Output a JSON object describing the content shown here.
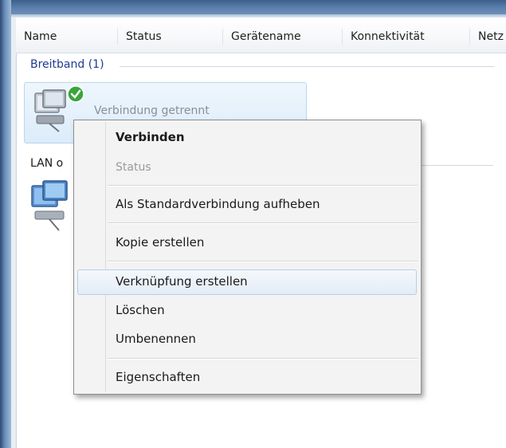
{
  "columns": [
    "Name",
    "Status",
    "Gerätename",
    "Konnektivität",
    "Netz"
  ],
  "groups": {
    "broadband": {
      "label": "Breitband (1)"
    },
    "lan": {
      "label": "LAN o"
    }
  },
  "connection": {
    "name": "Verbindung getrennt",
    "icon": "network-computer-icon",
    "badge_icon": "check-badge-icon"
  },
  "context_menu": {
    "items": [
      {
        "label": "Verbinden",
        "style": "bold"
      },
      {
        "label": "Status",
        "style": "disabled"
      },
      {
        "label": "Als Standardverbindung aufheben"
      },
      {
        "label": "Kopie erstellen"
      },
      {
        "label": "Verknüpfung erstellen",
        "state": "hover"
      },
      {
        "label": "Löschen"
      },
      {
        "label": "Umbenennen"
      },
      {
        "label": "Eigenschaften"
      }
    ]
  },
  "colors": {
    "group_header": "#1e3d8f",
    "selection": "#dcecfa",
    "badge": "#3aa53a"
  }
}
